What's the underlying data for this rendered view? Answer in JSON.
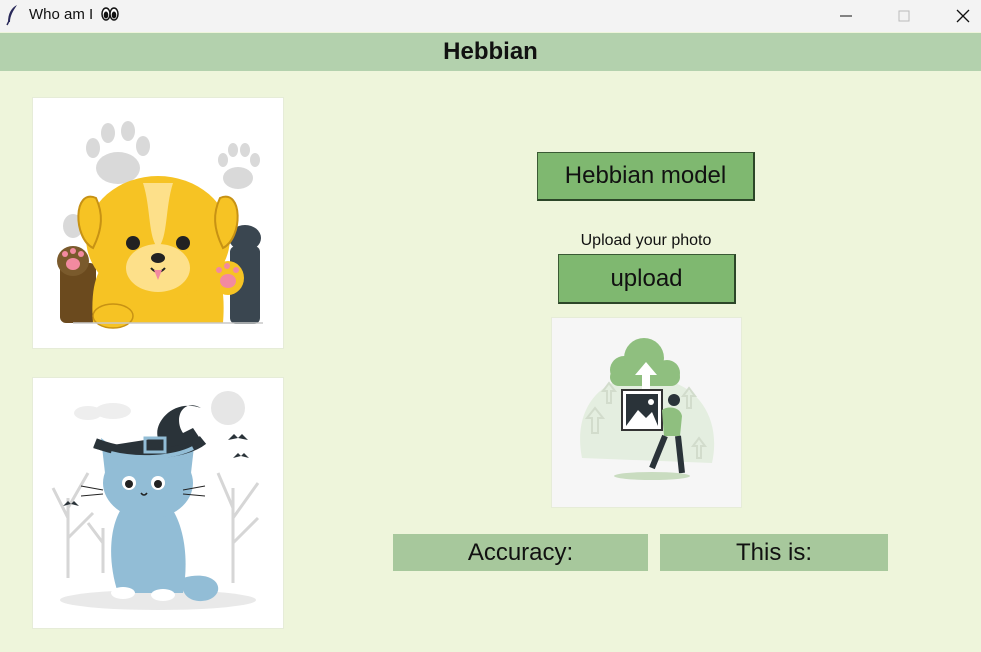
{
  "window": {
    "title": "Who am I",
    "minimize_icon": "minimize-icon",
    "maximize_icon": "maximize-icon",
    "close_icon": "close-icon"
  },
  "header": {
    "title": "Hebbian"
  },
  "images": {
    "dog": "dog-illustration",
    "cat": "cat-illustration",
    "upload": "upload-illustration"
  },
  "buttons": {
    "hebbian_model": "Hebbian model",
    "upload": "upload"
  },
  "upload_label": "Upload your photo",
  "results": {
    "accuracy_label": "Accuracy:",
    "this_is_label": "This is:"
  },
  "colors": {
    "background": "#eef5db",
    "header": "#b3d1ad",
    "button": "#7fb870",
    "result_box": "#a7c89c"
  }
}
